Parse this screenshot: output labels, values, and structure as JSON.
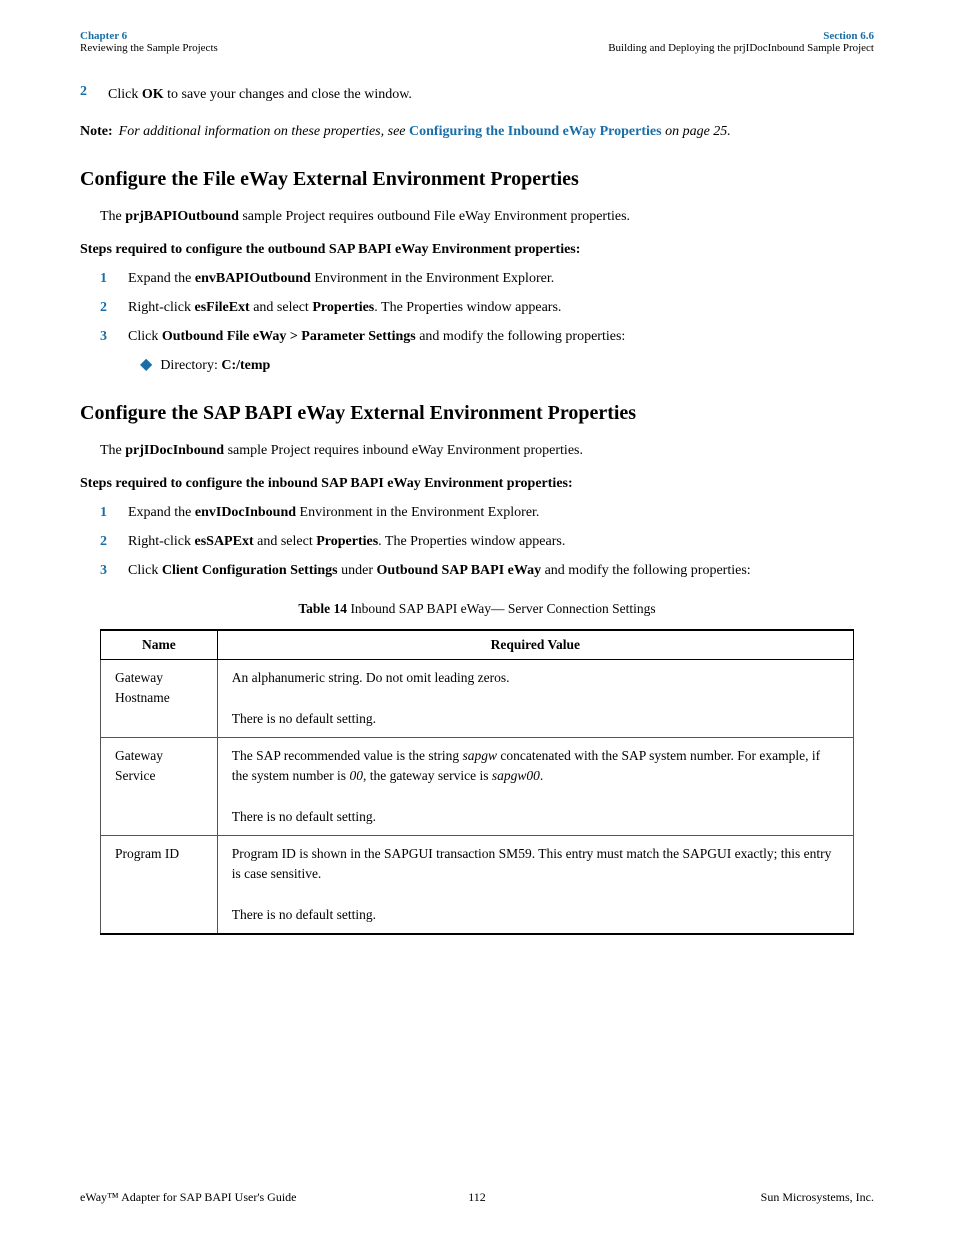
{
  "header": {
    "left_label": "Chapter 6",
    "left_subtitle": "Reviewing the Sample Projects",
    "right_label": "Section 6.6",
    "right_subtitle": "Building and Deploying the prjIDocInbound Sample Project"
  },
  "step2_ok": "2",
  "step2_text": "Click ",
  "step2_bold": "OK",
  "step2_rest": " to save your changes and close the window.",
  "note_label": "Note:",
  "note_text": "For additional information on these properties, see ",
  "note_link": "Configuring the Inbound eWay Properties",
  "note_link2": " on page 25.",
  "section1_heading": "Configure the File eWay External Environment Properties",
  "section1_intro_bold": "prjBAPIOutbound",
  "section1_intro_rest": " sample Project requires outbound File eWay Environment properties.",
  "section1_steps_heading": "Steps required to configure the outbound SAP BAPI eWay Environment properties:",
  "section1_steps": [
    {
      "num": "1",
      "text": "Expand the ",
      "bold": "envBAPIOutbound",
      "rest": " Environment in the Environment Explorer."
    },
    {
      "num": "2",
      "text": "Right-click ",
      "bold": "esFileExt",
      "rest": " and select ",
      "bold2": "Properties",
      "rest2": ". The Properties window appears."
    },
    {
      "num": "3",
      "text": "Click ",
      "bold": "Outbound File eWay > Parameter Settings",
      "rest": " and modify the following properties:"
    }
  ],
  "section1_bullet_label": "Directory:",
  "section1_bullet_value": "C:/temp",
  "section2_heading": "Configure the SAP BAPI eWay External Environment Properties",
  "section2_intro_bold": "prjIDocInbound",
  "section2_intro_rest": " sample Project requires inbound eWay Environment properties.",
  "section2_steps_heading": "Steps required to configure the inbound SAP BAPI eWay Environment properties:",
  "section2_steps": [
    {
      "num": "1",
      "text": "Expand the ",
      "bold": "envIDocInbound",
      "rest": " Environment in the Environment Explorer."
    },
    {
      "num": "2",
      "text": "Right-click ",
      "bold": "esSAPExt",
      "rest": " and select ",
      "bold2": "Properties",
      "rest2": ". The Properties window appears."
    },
    {
      "num": "3",
      "text": "Click ",
      "bold": "Client Configuration Settings",
      "rest": " under ",
      "bold2": "Outbound SAP BAPI eWay",
      "rest2": " and modify the following properties:"
    }
  ],
  "table_caption_label": "Table 14",
  "table_caption_text": "  Inbound SAP BAPI eWay— Server Connection Settings",
  "table_headers": [
    "Name",
    "Required Value"
  ],
  "table_rows": [
    {
      "name": "Gateway Hostname",
      "value": "An alphanumeric string. Do not omit leading zeros.\n\nThere is no default setting."
    },
    {
      "name": "Gateway Service",
      "value": "The SAP recommended value is the string sapgw concatenated with the SAP system number. For example, if the system number is 00, the gateway service is sapgw00.\n\nThere is no default setting."
    },
    {
      "name": "Program ID",
      "value": "Program ID is shown in the SAPGUI transaction SM59. This entry must match the SAPGUI exactly; this entry is case sensitive.\n\nThere is no default setting."
    }
  ],
  "table_row2_italic1": "sapgw",
  "table_row2_italic2": "sapgw00",
  "footer_left": "eWay™ Adapter for SAP BAPI User's Guide",
  "footer_center": "112",
  "footer_right": "Sun Microsystems, Inc."
}
